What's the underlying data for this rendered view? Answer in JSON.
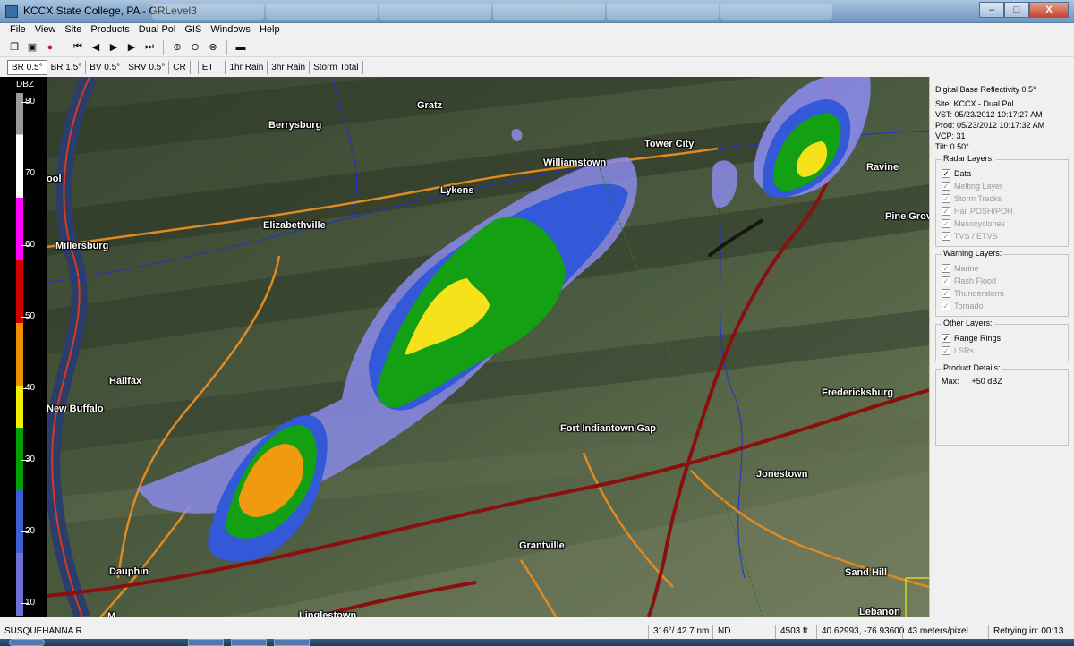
{
  "window": {
    "title": "KCCX State College, PA - GRLevel3",
    "minimize": "–",
    "maximize": "□",
    "close": "X"
  },
  "menu": [
    "File",
    "View",
    "Site",
    "Products",
    "Dual Pol",
    "GIS",
    "Windows",
    "Help"
  ],
  "toolbar": {
    "icons": [
      "copy-icon",
      "paste-icon",
      "alert-icon",
      "first-frame-icon",
      "prev-frame-icon",
      "play-icon",
      "next-frame-icon",
      "last-frame-icon",
      "zoom-in-icon",
      "zoom-out-icon",
      "zoom-reset-icon",
      "window-icon"
    ]
  },
  "product_tabs": [
    "BR 0.5°",
    "BR 1.5°",
    "BV 0.5°",
    "SRV 0.5°",
    "CR",
    "ET",
    "1hr Rain",
    "3hr Rain",
    "Storm Total"
  ],
  "legend": {
    "unit": "DBZ",
    "ticks": [
      "80",
      "70",
      "60",
      "50",
      "40",
      "30",
      "20",
      "10"
    ],
    "colors": [
      "#6f6fd8",
      "#3a5fd0",
      "#00a000",
      "#f0f000",
      "#f09000",
      "#d00000",
      "#ff00ff",
      "#ffffff",
      "#9a9a9a"
    ]
  },
  "map": {
    "labels": [
      "Gratz",
      "Berrysburg",
      "Tower City",
      "Williamstown",
      "Ravine",
      "Lykens",
      "Elizabethville",
      "Pine Grov",
      "Millersburg",
      "ool",
      "Halifax",
      "New Buffalo",
      "Fredericksburg",
      "Fort Indiantown Gap",
      "Jonestown",
      "Grantville",
      "Dauphin",
      "Sand Hill",
      "Lebanon",
      "Linglestown",
      "M"
    ]
  },
  "panel": {
    "product": "Digital Base Reflectivity 0.5°",
    "site": "Site:  KCCX - Dual Pol",
    "vst": "VST:  05/23/2012  10:17:27 AM",
    "prod": "Prod: 05/23/2012  10:17:32 AM",
    "vcp": "VCP:  31",
    "tilt": "Tilt:  0.50°",
    "radar_layers": {
      "title": "Radar Layers:",
      "items": [
        {
          "label": "Data",
          "checked": true,
          "enabled": true
        },
        {
          "label": "Melting Layer",
          "checked": true,
          "enabled": false
        },
        {
          "label": "Storm Tracks",
          "checked": true,
          "enabled": false
        },
        {
          "label": "Hail POSH/POH",
          "checked": true,
          "enabled": false
        },
        {
          "label": "Mesocyclones",
          "checked": true,
          "enabled": false
        },
        {
          "label": "TVS / ETVS",
          "checked": true,
          "enabled": false
        }
      ]
    },
    "warning_layers": {
      "title": "Warning Layers:",
      "items": [
        {
          "label": "Marine",
          "checked": true,
          "enabled": false
        },
        {
          "label": "Flash Flood",
          "checked": true,
          "enabled": false
        },
        {
          "label": "Thunderstorm",
          "checked": true,
          "enabled": false
        },
        {
          "label": "Tornado",
          "checked": true,
          "enabled": false
        }
      ]
    },
    "other_layers": {
      "title": "Other Layers:",
      "items": [
        {
          "label": "Range Rings",
          "checked": true,
          "enabled": true
        },
        {
          "label": "LSRs",
          "checked": true,
          "enabled": false
        }
      ]
    },
    "details": {
      "title": "Product Details:",
      "max_label": "Max:",
      "max_value": "+50 dBZ"
    }
  },
  "status": {
    "location": "SUSQUEHANNA R",
    "bearing": "316°/ 42.7 nm",
    "value": "ND",
    "height": "4503 ft",
    "coords": "40.62993, -76.93600",
    "resolution": "43 meters/pixel",
    "retry": "Retrying in: 00:13"
  }
}
